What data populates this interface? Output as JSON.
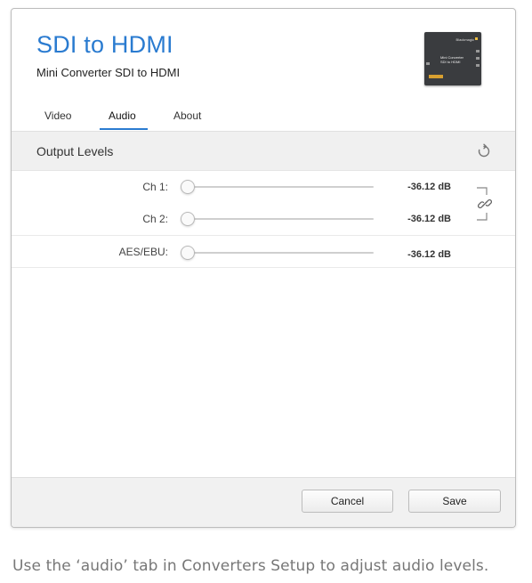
{
  "header": {
    "title": "SDI to HDMI",
    "subtitle": "Mini Converter SDI to HDMI",
    "device_brand": "Blackmagic",
    "device_name_line1": "Mini Converter",
    "device_name_line2": "SDI to HDMI"
  },
  "tabs": [
    {
      "label": "Video",
      "active": false
    },
    {
      "label": "Audio",
      "active": true
    },
    {
      "label": "About",
      "active": false
    }
  ],
  "section": {
    "title": "Output Levels",
    "reset_icon": "reset-icon"
  },
  "levels": [
    {
      "label": "Ch 1:",
      "value": "-36.12 dB",
      "slider_position": 0.0
    },
    {
      "label": "Ch 2:",
      "value": "-36.12 dB",
      "slider_position": 0.0
    },
    {
      "label": "AES/EBU:",
      "value": "-36.12 dB",
      "slider_position": 0.0
    }
  ],
  "link_icon": "chain-link-icon",
  "footer": {
    "cancel_label": "Cancel",
    "save_label": "Save"
  },
  "caption": "Use the ‘audio’ tab in Converters Setup to adjust audio levels.",
  "colors": {
    "accent": "#2a7bd0",
    "header_bg": "#f0f0f0",
    "footer_bg": "#f1f1f1"
  }
}
